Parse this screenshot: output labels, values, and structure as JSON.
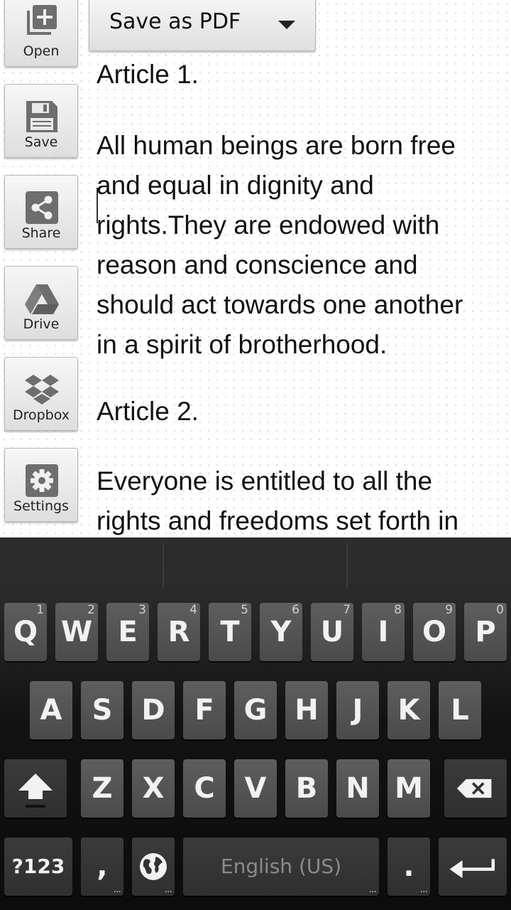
{
  "toolbar": {
    "open_label": "Open",
    "save_label": "Save",
    "share_label": "Share",
    "drive_label": "Drive",
    "dropbox_label": "Dropbox",
    "settings_label": "Settings"
  },
  "export": {
    "selected": "Save as PDF"
  },
  "document": {
    "lines": [
      "Article 1.",
      "All human beings are born free",
      "and equal in dignity and",
      "rights.They are endowed with",
      "reason and conscience and",
      "should act towards one another",
      "in a spirit of brotherhood.",
      "Article 2.",
      "Everyone is entitled to all the",
      "rights and freedoms set forth in"
    ]
  },
  "keyboard": {
    "row1": [
      {
        "label": "Q",
        "hint": "1"
      },
      {
        "label": "W",
        "hint": "2"
      },
      {
        "label": "E",
        "hint": "3"
      },
      {
        "label": "R",
        "hint": "4"
      },
      {
        "label": "T",
        "hint": "5"
      },
      {
        "label": "Y",
        "hint": "6"
      },
      {
        "label": "U",
        "hint": "7"
      },
      {
        "label": "I",
        "hint": "8"
      },
      {
        "label": "O",
        "hint": "9"
      },
      {
        "label": "P",
        "hint": "0"
      }
    ],
    "row2": [
      "A",
      "S",
      "D",
      "F",
      "G",
      "H",
      "J",
      "K",
      "L"
    ],
    "row3": [
      "Z",
      "X",
      "C",
      "V",
      "B",
      "N",
      "M"
    ],
    "symbols_label": "?123",
    "comma_label": ",",
    "space_label": "English (US)",
    "period_label": ".",
    "more_dots": "..."
  },
  "icons": {
    "open": "open-file-icon",
    "save": "floppy-disk-icon",
    "share": "share-icon",
    "drive": "google-drive-icon",
    "dropbox": "dropbox-icon",
    "settings": "gear-icon",
    "dropdown": "triangle-down-icon",
    "shift": "shift-arrow-icon",
    "backspace": "backspace-icon",
    "globe": "globe-icon",
    "enter": "enter-arrow-icon"
  },
  "colors": {
    "icon_gray": "#6e6e6e",
    "keyboard_bg": "#1e1e1e",
    "key_face": "#555555",
    "key_text": "#f2f2f2"
  }
}
